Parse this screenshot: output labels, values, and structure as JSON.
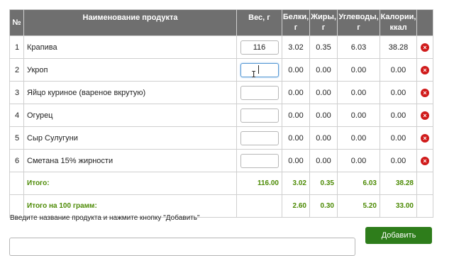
{
  "table": {
    "headers": {
      "num": "№",
      "name": "Наименование продукта",
      "weight": "Вес, г",
      "protein": "Белки, г",
      "fat": "Жиры, г",
      "carbs": "Углеводы, г",
      "calories": "Калории, ккал"
    },
    "rows": [
      {
        "num": "1",
        "name": "Крапива",
        "weight": "116",
        "protein": "3.02",
        "fat": "0.35",
        "carbs": "6.03",
        "calories": "38.28"
      },
      {
        "num": "2",
        "name": "Укроп",
        "weight": "",
        "protein": "0.00",
        "fat": "0.00",
        "carbs": "0.00",
        "calories": "0.00"
      },
      {
        "num": "3",
        "name": "Яйцо куриное (вареное вкрутую)",
        "weight": "",
        "protein": "0.00",
        "fat": "0.00",
        "carbs": "0.00",
        "calories": "0.00"
      },
      {
        "num": "4",
        "name": "Огурец",
        "weight": "",
        "protein": "0.00",
        "fat": "0.00",
        "carbs": "0.00",
        "calories": "0.00"
      },
      {
        "num": "5",
        "name": "Сыр Сулугуни",
        "weight": "",
        "protein": "0.00",
        "fat": "0.00",
        "carbs": "0.00",
        "calories": "0.00"
      },
      {
        "num": "6",
        "name": "Сметана 15% жирности",
        "weight": "",
        "protein": "0.00",
        "fat": "0.00",
        "carbs": "0.00",
        "calories": "0.00"
      }
    ],
    "delete_glyph": "×",
    "total": {
      "label": "Итого:",
      "weight": "116.00",
      "protein": "3.02",
      "fat": "0.35",
      "carbs": "6.03",
      "calories": "38.28"
    },
    "per100": {
      "label": "Итого на 100 грамм:",
      "protein": "2.60",
      "fat": "0.30",
      "carbs": "5.20",
      "calories": "33.00"
    }
  },
  "hint": "Введите название продукта и нажмите кнопку \"Добавить\"",
  "add_input": {
    "value": "",
    "placeholder": ""
  },
  "add_button": "Добавить",
  "colors": {
    "header_bg": "#6f6f6f",
    "total_text": "#4c8a04",
    "add_button": "#2e7d1b",
    "delete": "#d01b1b"
  },
  "icons": {
    "delete": "delete-x-icon",
    "text_cursor": "ibeam-cursor-icon"
  }
}
